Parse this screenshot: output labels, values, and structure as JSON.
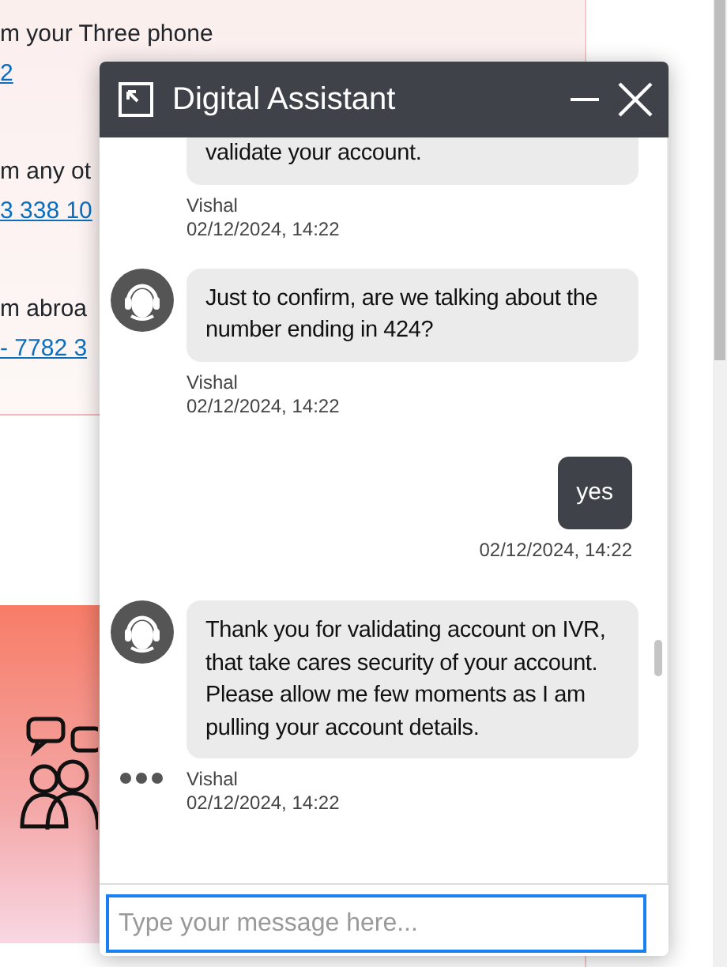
{
  "background_page": {
    "sections": [
      {
        "text": "m your Three phone",
        "link": "2"
      },
      {
        "text": "m any ot",
        "link": "3 338 10"
      },
      {
        "text": "m abroa",
        "link": "- 7782 3"
      }
    ]
  },
  "chat": {
    "title": "Digital Assistant",
    "messages": [
      {
        "kind": "agent",
        "show_avatar": false,
        "text": "validate your account.",
        "author": "Vishal",
        "time": "02/12/2024, 14:22"
      },
      {
        "kind": "agent",
        "show_avatar": true,
        "text": "Just to confirm, are we talking about the number ending in 424?",
        "author": "Vishal",
        "time": "02/12/2024, 14:22"
      },
      {
        "kind": "user",
        "text": "yes",
        "time": "02/12/2024, 14:22"
      },
      {
        "kind": "agent",
        "show_avatar": true,
        "text": "Thank you for validating account on IVR, that take cares security of your account. Please allow me few moments as I am pulling your account details.",
        "author": "Vishal",
        "time": "02/12/2024, 14:22"
      }
    ],
    "typing": true,
    "input": {
      "placeholder": "Type your message here..."
    }
  }
}
